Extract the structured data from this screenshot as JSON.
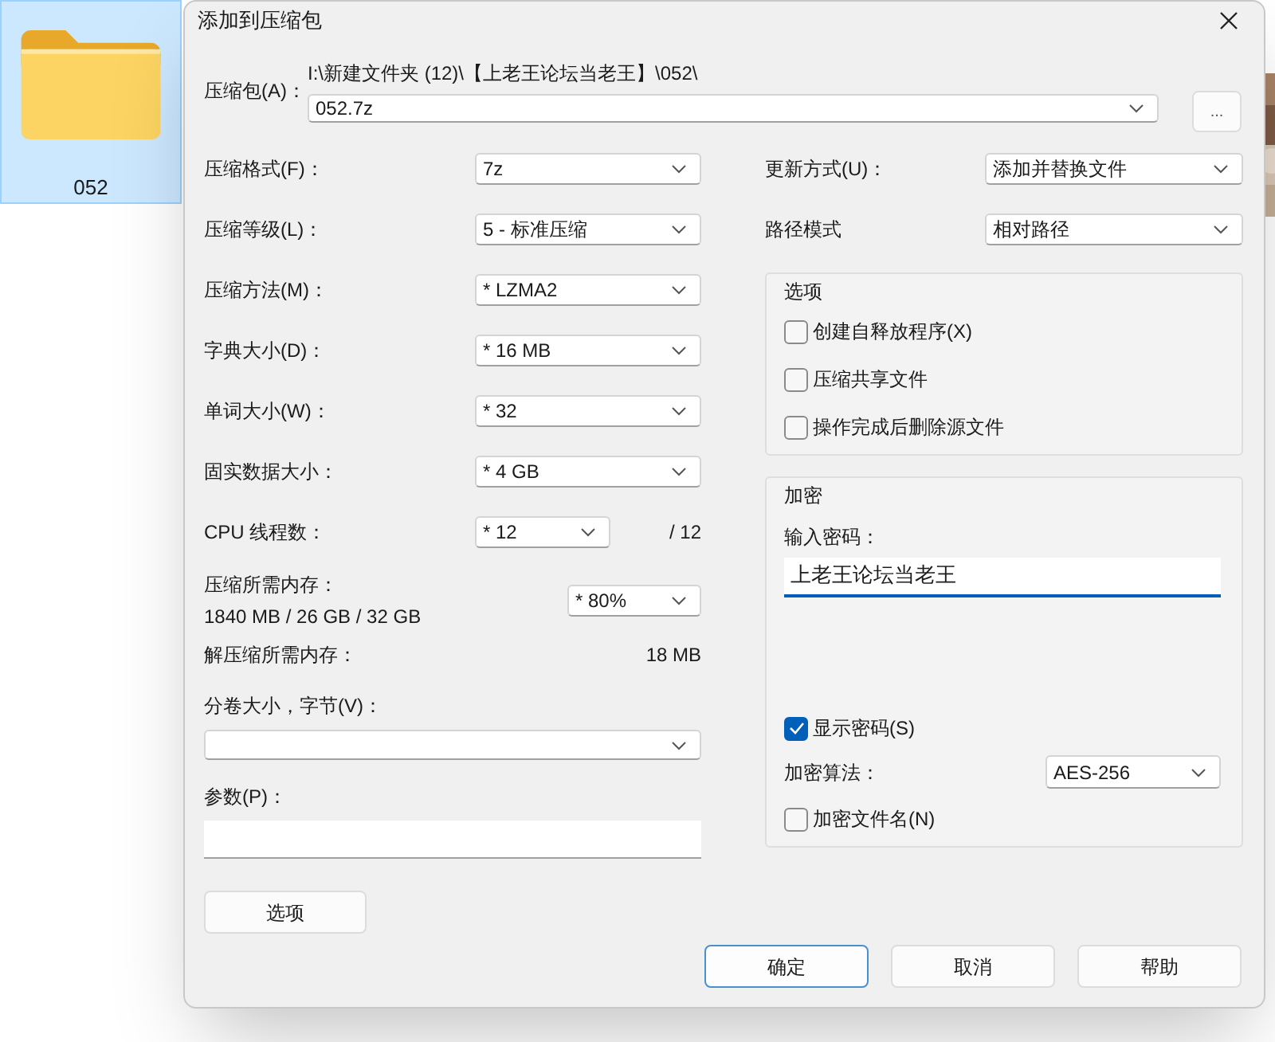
{
  "desktop_item": {
    "label": "052",
    "selected": true
  },
  "window": {
    "title": "添加到压缩包"
  },
  "archive": {
    "label": "压缩包(A)：",
    "path": "I:\\新建文件夹 (12)\\【上老王论坛当老王】\\052\\",
    "value": "052.7z",
    "browse_button": "..."
  },
  "settings": [
    {
      "kind": "select",
      "label": "压缩格式(F)：",
      "value": "7z"
    },
    {
      "kind": "select",
      "label": "压缩等级(L)：",
      "value": "5 - 标准压缩"
    },
    {
      "kind": "select",
      "label": "压缩方法(M)：",
      "value": "* LZMA2"
    },
    {
      "kind": "select",
      "label": "字典大小(D)：",
      "value": "* 16 MB"
    },
    {
      "kind": "select",
      "label": "单词大小(W)：",
      "value": "* 32"
    },
    {
      "kind": "select",
      "label": "固实数据大小：",
      "value": "* 4 GB"
    },
    {
      "kind": "select_suffix",
      "label": "CPU 线程数：",
      "value": "* 12",
      "suffix": "/ 12"
    },
    {
      "kind": "memory",
      "label": "压缩所需内存：",
      "detail": "1840 MB / 26 GB / 32 GB",
      "value": "* 80%"
    },
    {
      "kind": "readout",
      "label": "解压缩所需内存：",
      "value": "18 MB"
    }
  ],
  "volume": {
    "label": "分卷大小，字节(V)："
  },
  "parameters": {
    "label": "参数(P)："
  },
  "options_button": "选项",
  "update_mode": {
    "label": "更新方式(U)：",
    "value": "添加并替换文件"
  },
  "path_mode": {
    "label": "路径模式",
    "value": "相对路径"
  },
  "options_group": {
    "title": "选项",
    "checkboxes": [
      {
        "label": "创建自释放程序(X)",
        "checked": false
      },
      {
        "label": "压缩共享文件",
        "checked": false
      },
      {
        "label": "操作完成后删除源文件",
        "checked": false
      }
    ]
  },
  "encryption": {
    "title": "加密",
    "password_label": "输入密码：",
    "password": "上老王论坛当老王",
    "show_password": {
      "label": "显示密码(S)",
      "checked": true
    },
    "method": {
      "label": "加密算法：",
      "value": "AES-256"
    },
    "encrypt_names": {
      "label": "加密文件名(N)",
      "checked": false
    }
  },
  "buttons": [
    {
      "label": "确定",
      "default": true
    },
    {
      "label": "取消",
      "default": false
    },
    {
      "label": "帮助",
      "default": false
    }
  ]
}
